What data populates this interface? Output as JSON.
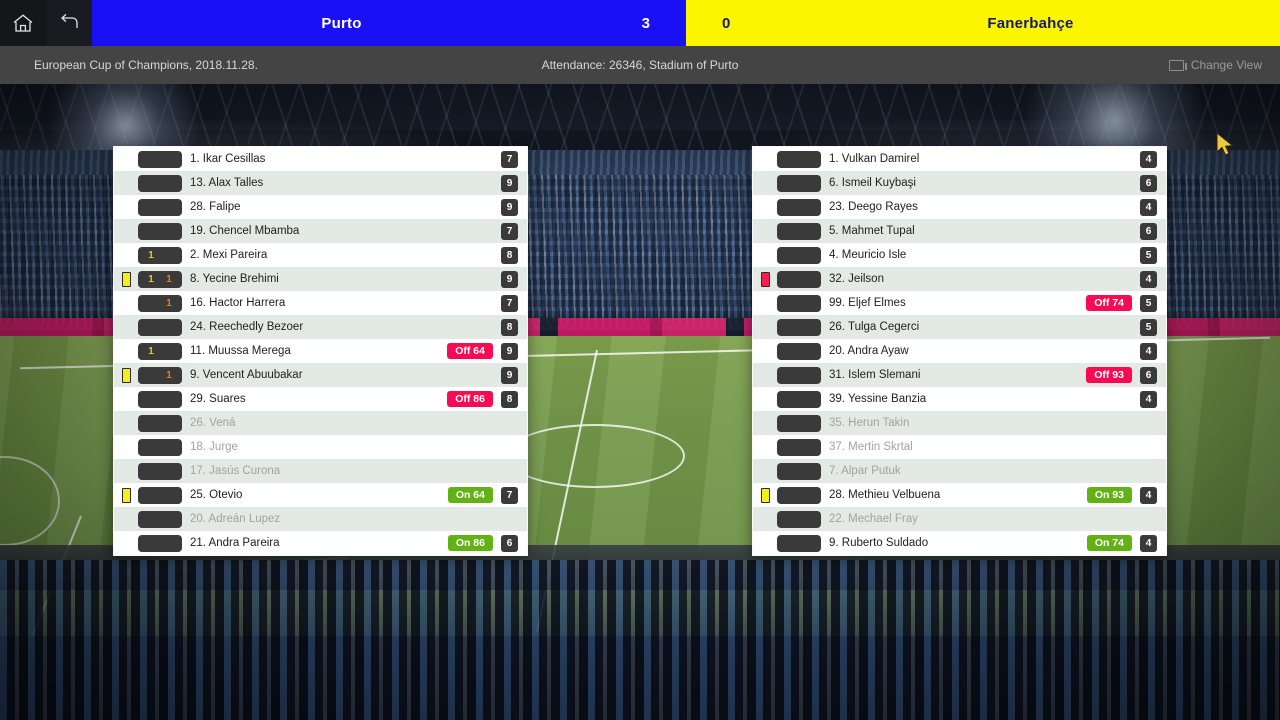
{
  "nav": {
    "home_label": "Home",
    "back_label": "Back"
  },
  "scoreboard": {
    "home_team": "Purto",
    "home_score": "3",
    "away_score": "0",
    "away_team": "Fanerbahçe",
    "home_color": "#1a10f5",
    "away_color": "#fbf500"
  },
  "info": {
    "competition": "European Cup of Champions, 2018.11.28.",
    "venue": "Attendance: 26346, Stadium of Purto",
    "change_view_label": "Change View"
  },
  "home_lineup": [
    {
      "name": "1. Ikar Cesillas",
      "card": "",
      "goals": "",
      "assists": "",
      "sub": "",
      "sub_type": "",
      "rating": "7",
      "used": true
    },
    {
      "name": "13. Alax Talles",
      "card": "",
      "goals": "",
      "assists": "",
      "sub": "",
      "sub_type": "",
      "rating": "9",
      "used": true
    },
    {
      "name": "28. Falipe",
      "card": "",
      "goals": "",
      "assists": "",
      "sub": "",
      "sub_type": "",
      "rating": "9",
      "used": true
    },
    {
      "name": "19. Chencel Mbamba",
      "card": "",
      "goals": "",
      "assists": "",
      "sub": "",
      "sub_type": "",
      "rating": "7",
      "used": true
    },
    {
      "name": "2. Mexi Pareira",
      "card": "",
      "goals": "1",
      "assists": "",
      "sub": "",
      "sub_type": "",
      "rating": "8",
      "used": true
    },
    {
      "name": "8. Yecine Brehimi",
      "card": "yellow",
      "goals": "1",
      "assists": "1",
      "sub": "",
      "sub_type": "",
      "rating": "9",
      "used": true
    },
    {
      "name": "16. Hactor Harrera",
      "card": "",
      "goals": "",
      "assists": "1",
      "sub": "",
      "sub_type": "",
      "rating": "7",
      "used": true
    },
    {
      "name": "24. Reechedly Bezoer",
      "card": "",
      "goals": "",
      "assists": "",
      "sub": "",
      "sub_type": "",
      "rating": "8",
      "used": true
    },
    {
      "name": "11. Muussa Merega",
      "card": "",
      "goals": "1",
      "assists": "",
      "sub": "Off 64",
      "sub_type": "off",
      "rating": "9",
      "used": true
    },
    {
      "name": "9. Vencent Abuubakar",
      "card": "yellow",
      "goals": "",
      "assists": "1",
      "sub": "",
      "sub_type": "",
      "rating": "9",
      "used": true
    },
    {
      "name": "29. Suares",
      "card": "",
      "goals": "",
      "assists": "",
      "sub": "Off 86",
      "sub_type": "off",
      "rating": "8",
      "used": true
    },
    {
      "name": "26. Vená",
      "card": "",
      "goals": "",
      "assists": "",
      "sub": "",
      "sub_type": "",
      "rating": "",
      "used": false
    },
    {
      "name": "18. Jurge",
      "card": "",
      "goals": "",
      "assists": "",
      "sub": "",
      "sub_type": "",
      "rating": "",
      "used": false
    },
    {
      "name": "17. Jasús Curona",
      "card": "",
      "goals": "",
      "assists": "",
      "sub": "",
      "sub_type": "",
      "rating": "",
      "used": false
    },
    {
      "name": "25. Otevio",
      "card": "yellow",
      "goals": "",
      "assists": "",
      "sub": "On 64",
      "sub_type": "on",
      "rating": "7",
      "used": true
    },
    {
      "name": "20. Adreán Lupez",
      "card": "",
      "goals": "",
      "assists": "",
      "sub": "",
      "sub_type": "",
      "rating": "",
      "used": false
    },
    {
      "name": "21. Andra Pareira",
      "card": "",
      "goals": "",
      "assists": "",
      "sub": "On 86",
      "sub_type": "on",
      "rating": "6",
      "used": true
    }
  ],
  "away_lineup": [
    {
      "name": "1. Vulkan Damirel",
      "card": "",
      "goals": "",
      "assists": "",
      "sub": "",
      "sub_type": "",
      "rating": "4",
      "used": true
    },
    {
      "name": "6. Ismeil Kuybaşi",
      "card": "",
      "goals": "",
      "assists": "",
      "sub": "",
      "sub_type": "",
      "rating": "6",
      "used": true
    },
    {
      "name": "23. Deego Rayes",
      "card": "",
      "goals": "",
      "assists": "",
      "sub": "",
      "sub_type": "",
      "rating": "4",
      "used": true
    },
    {
      "name": "5. Mahmet Tupal",
      "card": "",
      "goals": "",
      "assists": "",
      "sub": "",
      "sub_type": "",
      "rating": "6",
      "used": true
    },
    {
      "name": "4. Meuricio Isle",
      "card": "",
      "goals": "",
      "assists": "",
      "sub": "",
      "sub_type": "",
      "rating": "5",
      "used": true
    },
    {
      "name": "32. Jeilson",
      "card": "red",
      "goals": "",
      "assists": "",
      "sub": "",
      "sub_type": "",
      "rating": "4",
      "used": true
    },
    {
      "name": "99. Eljef Elmes",
      "card": "",
      "goals": "",
      "assists": "",
      "sub": "Off 74",
      "sub_type": "off",
      "rating": "5",
      "used": true
    },
    {
      "name": "26. Tulga Cegerci",
      "card": "",
      "goals": "",
      "assists": "",
      "sub": "",
      "sub_type": "",
      "rating": "5",
      "used": true
    },
    {
      "name": "20. Andra Ayaw",
      "card": "",
      "goals": "",
      "assists": "",
      "sub": "",
      "sub_type": "",
      "rating": "4",
      "used": true
    },
    {
      "name": "31. Islem Slemani",
      "card": "",
      "goals": "",
      "assists": "",
      "sub": "Off 93",
      "sub_type": "off",
      "rating": "6",
      "used": true
    },
    {
      "name": "39. Yessine Banzia",
      "card": "",
      "goals": "",
      "assists": "",
      "sub": "",
      "sub_type": "",
      "rating": "4",
      "used": true
    },
    {
      "name": "35. Herun Takin",
      "card": "",
      "goals": "",
      "assists": "",
      "sub": "",
      "sub_type": "",
      "rating": "",
      "used": false
    },
    {
      "name": "37. Mertin Skrtal",
      "card": "",
      "goals": "",
      "assists": "",
      "sub": "",
      "sub_type": "",
      "rating": "",
      "used": false
    },
    {
      "name": "7. Alpar Putuk",
      "card": "",
      "goals": "",
      "assists": "",
      "sub": "",
      "sub_type": "",
      "rating": "",
      "used": false
    },
    {
      "name": "28. Methieu Velbuena",
      "card": "yellow",
      "goals": "",
      "assists": "",
      "sub": "On 93",
      "sub_type": "on",
      "rating": "4",
      "used": true
    },
    {
      "name": "22. Mechael Fray",
      "card": "",
      "goals": "",
      "assists": "",
      "sub": "",
      "sub_type": "",
      "rating": "",
      "used": false
    },
    {
      "name": "9. Ruberto Suldado",
      "card": "",
      "goals": "",
      "assists": "",
      "sub": "On 74",
      "sub_type": "on",
      "rating": "4",
      "used": true
    }
  ]
}
